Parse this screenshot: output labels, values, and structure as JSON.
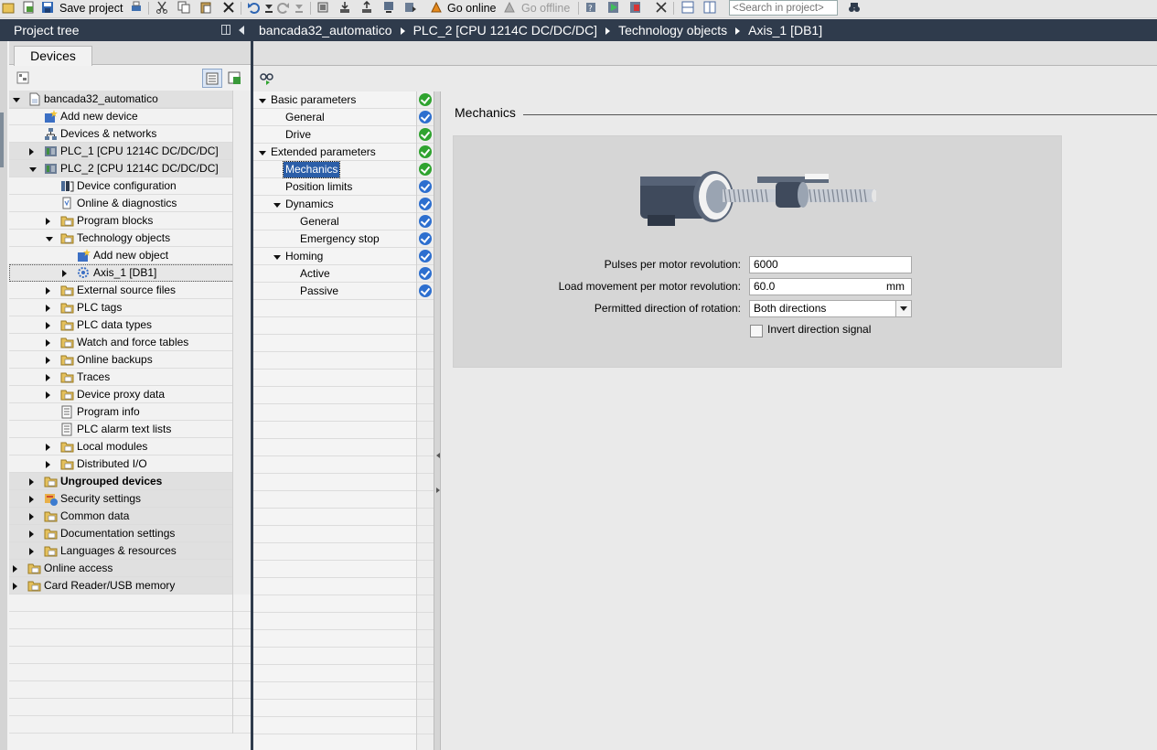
{
  "toolbar": {
    "save_project": "Save project",
    "go_online": "Go online",
    "go_offline": "Go offline",
    "search_placeholder": "<Search in project>"
  },
  "project_tree": {
    "title": "Project tree",
    "devices_tab": "Devices",
    "items": [
      {
        "label": "bancada32_automatico",
        "level": 0,
        "expander": "down",
        "icon": "project-icon",
        "bold": false,
        "band": true
      },
      {
        "label": "Add new device",
        "level": 1,
        "expander": "none",
        "icon": "add-device-icon",
        "bold": false,
        "band": false
      },
      {
        "label": "Devices & networks",
        "level": 1,
        "expander": "none",
        "icon": "network-icon",
        "bold": false,
        "band": false
      },
      {
        "label": "PLC_1 [CPU 1214C DC/DC/DC]",
        "level": 1,
        "expander": "right",
        "icon": "plc-icon",
        "bold": false,
        "band": true
      },
      {
        "label": "PLC_2 [CPU 1214C DC/DC/DC]",
        "level": 1,
        "expander": "down",
        "icon": "plc-icon",
        "bold": false,
        "band": true
      },
      {
        "label": "Device configuration",
        "level": 2,
        "expander": "none",
        "icon": "device-config-icon",
        "bold": false,
        "band": false
      },
      {
        "label": "Online & diagnostics",
        "level": 2,
        "expander": "none",
        "icon": "diagnostics-icon",
        "bold": false,
        "band": false
      },
      {
        "label": "Program blocks",
        "level": 2,
        "expander": "right",
        "icon": "folder-icon",
        "bold": false,
        "band": false
      },
      {
        "label": "Technology objects",
        "level": 2,
        "expander": "down",
        "icon": "folder-icon",
        "bold": false,
        "band": false
      },
      {
        "label": "Add new object",
        "level": 3,
        "expander": "none",
        "icon": "add-object-icon",
        "bold": false,
        "band": false
      },
      {
        "label": "Axis_1 [DB1]",
        "level": 3,
        "expander": "right",
        "icon": "axis-icon",
        "bold": false,
        "band": false,
        "selected": true
      },
      {
        "label": "External source files",
        "level": 2,
        "expander": "right",
        "icon": "folder-icon",
        "bold": false,
        "band": false
      },
      {
        "label": "PLC tags",
        "level": 2,
        "expander": "right",
        "icon": "folder-icon",
        "bold": false,
        "band": false
      },
      {
        "label": "PLC data types",
        "level": 2,
        "expander": "right",
        "icon": "folder-icon",
        "bold": false,
        "band": false
      },
      {
        "label": "Watch and force tables",
        "level": 2,
        "expander": "right",
        "icon": "folder-icon",
        "bold": false,
        "band": false
      },
      {
        "label": "Online backups",
        "level": 2,
        "expander": "right",
        "icon": "folder-icon",
        "bold": false,
        "band": false
      },
      {
        "label": "Traces",
        "level": 2,
        "expander": "right",
        "icon": "folder-icon",
        "bold": false,
        "band": false
      },
      {
        "label": "Device proxy data",
        "level": 2,
        "expander": "right",
        "icon": "folder-icon",
        "bold": false,
        "band": false
      },
      {
        "label": "Program info",
        "level": 2,
        "expander": "none",
        "icon": "program-info-icon",
        "bold": false,
        "band": false
      },
      {
        "label": "PLC alarm text lists",
        "level": 2,
        "expander": "none",
        "icon": "alarm-list-icon",
        "bold": false,
        "band": false
      },
      {
        "label": "Local modules",
        "level": 2,
        "expander": "right",
        "icon": "folder-icon",
        "bold": false,
        "band": false
      },
      {
        "label": "Distributed I/O",
        "level": 2,
        "expander": "right",
        "icon": "folder-icon",
        "bold": false,
        "band": false
      },
      {
        "label": "Ungrouped devices",
        "level": 1,
        "expander": "right",
        "icon": "folder-icon",
        "bold": true,
        "band": true
      },
      {
        "label": "Security settings",
        "level": 1,
        "expander": "right",
        "icon": "security-icon",
        "bold": false,
        "band": true
      },
      {
        "label": "Common data",
        "level": 1,
        "expander": "right",
        "icon": "folder-icon",
        "bold": false,
        "band": true
      },
      {
        "label": "Documentation settings",
        "level": 1,
        "expander": "right",
        "icon": "folder-icon",
        "bold": false,
        "band": true
      },
      {
        "label": "Languages & resources",
        "level": 1,
        "expander": "right",
        "icon": "folder-icon",
        "bold": false,
        "band": true
      },
      {
        "label": "Online access",
        "level": 0,
        "expander": "right",
        "icon": "folder-icon",
        "bold": false,
        "band": true
      },
      {
        "label": "Card Reader/USB memory",
        "level": 0,
        "expander": "right",
        "icon": "folder-icon",
        "bold": false,
        "band": true
      }
    ]
  },
  "breadcrumb": [
    "bancada32_automatico",
    "PLC_2 [CPU 1214C DC/DC/DC]",
    "Technology objects",
    "Axis_1 [DB1]"
  ],
  "config_tree": [
    {
      "label": "Basic parameters",
      "level": 0,
      "expander": "down",
      "status": "green"
    },
    {
      "label": "General",
      "level": 1,
      "expander": "none",
      "status": "blue"
    },
    {
      "label": "Drive",
      "level": 1,
      "expander": "none",
      "status": "green"
    },
    {
      "label": "Extended parameters",
      "level": 0,
      "expander": "down",
      "status": "green"
    },
    {
      "label": "Mechanics",
      "level": 1,
      "expander": "none",
      "status": "green",
      "selected": true
    },
    {
      "label": "Position limits",
      "level": 1,
      "expander": "none",
      "status": "blue"
    },
    {
      "label": "Dynamics",
      "level": 1,
      "expander": "down",
      "status": "blue"
    },
    {
      "label": "General",
      "level": 2,
      "expander": "none",
      "status": "blue"
    },
    {
      "label": "Emergency stop",
      "level": 2,
      "expander": "none",
      "status": "blue"
    },
    {
      "label": "Homing",
      "level": 1,
      "expander": "down",
      "status": "blue"
    },
    {
      "label": "Active",
      "level": 2,
      "expander": "none",
      "status": "blue"
    },
    {
      "label": "Passive",
      "level": 2,
      "expander": "none",
      "status": "blue"
    }
  ],
  "status_colors": {
    "green": "#2fa32f",
    "blue": "#2d6fcf"
  },
  "mechanics": {
    "title": "Mechanics",
    "pulses_label": "Pulses per motor revolution:",
    "pulses_value": "6000",
    "load_label": "Load movement per motor revolution:",
    "load_value": "60.0",
    "load_unit": "mm",
    "direction_label": "Permitted direction of rotation:",
    "direction_value": "Both directions",
    "invert_label": "Invert direction signal",
    "invert_checked": false
  }
}
